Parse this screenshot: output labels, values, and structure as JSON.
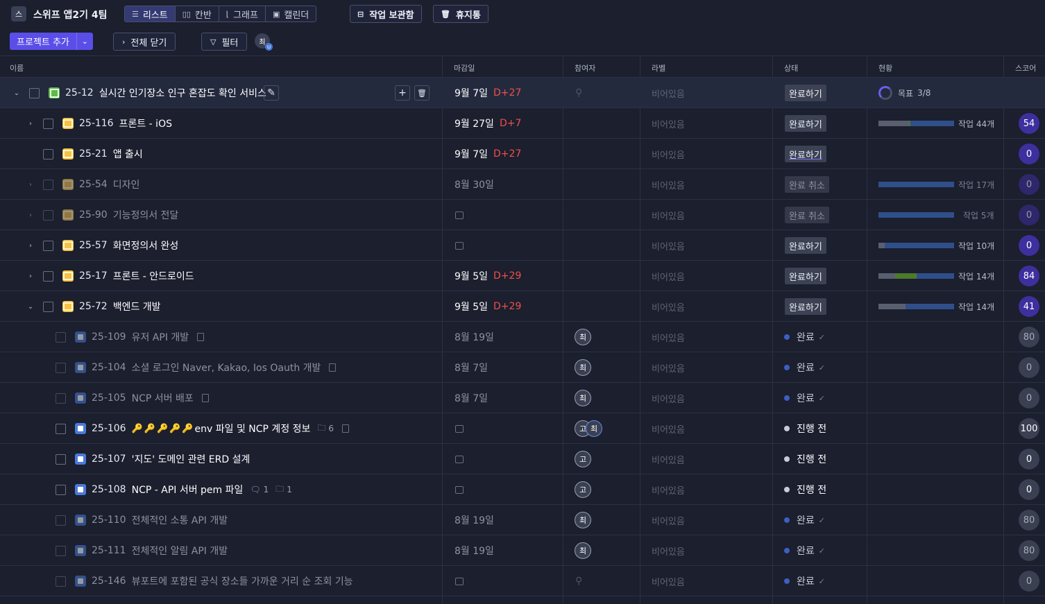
{
  "app": {
    "team_logo": "스",
    "team_name": "스위프 앱2기 4팀"
  },
  "views": {
    "list": "리스트",
    "kanban": "칸반",
    "graph": "그래프",
    "calendar": "캘린더"
  },
  "top_buttons": {
    "archive": "작업 보관함",
    "trash": "휴지통"
  },
  "toolbar": {
    "add_project": "프로젝트 추가",
    "collapse_all": "전체 닫기",
    "filter": "필터",
    "filter_avatar": "최"
  },
  "columns": {
    "name": "이름",
    "due": "마감일",
    "participants": "참여자",
    "label": "라벨",
    "status": "상태",
    "progress": "현황",
    "score": "스코어"
  },
  "rows": [
    {
      "code": "25-12",
      "title": "실시간 인기장소 인구 혼잡도 확인 서비스",
      "date": "9월 7일",
      "dday": "D+27",
      "label": "비어있음",
      "status": "완료하기",
      "goal": "목표",
      "goal_count": "3/8"
    },
    {
      "code": "25-116",
      "title": "프론트 - iOS",
      "date": "9월 27일",
      "dday": "D+7",
      "label": "비어있음",
      "status": "완료하기",
      "tasks": "작업 44개",
      "score": "54",
      "progress": {
        "gray": 0.4,
        "green": 0.02
      }
    },
    {
      "code": "25-21",
      "title": "앱 출시",
      "date": "9월 7일",
      "dday": "D+27",
      "label": "비어있음",
      "status": "완료하기",
      "score": "0"
    },
    {
      "code": "25-54",
      "title": "디자인",
      "date": "8월 30일",
      "label": "비어있음",
      "status": "완료 취소",
      "tasks": "작업 17개",
      "score": "0",
      "progress": {
        "gray": 0,
        "green": 0
      }
    },
    {
      "code": "25-90",
      "title": "기능정의서 전달",
      "label": "비어있음",
      "status": "완료 취소",
      "tasks": "작업 5개",
      "score": "0",
      "progress": {
        "gray": 0,
        "green": 0
      }
    },
    {
      "code": "25-57",
      "title": "화면정의서 완성",
      "label": "비어있음",
      "status": "완료하기",
      "tasks": "작업 10개",
      "score": "0",
      "progress": {
        "gray": 0.08,
        "green": 0
      }
    },
    {
      "code": "25-17",
      "title": "프론트 - 안드로이드",
      "date": "9월 5일",
      "dday": "D+29",
      "label": "비어있음",
      "status": "완료하기",
      "tasks": "작업 14개",
      "score": "84",
      "progress": {
        "gray": 0.22,
        "green": 0.28
      }
    },
    {
      "code": "25-72",
      "title": "백엔드 개발",
      "date": "9월 5일",
      "dday": "D+29",
      "label": "비어있음",
      "status": "완료하기",
      "tasks": "작업 14개",
      "score": "41",
      "progress": {
        "gray": 0.36,
        "green": 0
      }
    },
    {
      "code": "25-109",
      "title": "유저 API 개발",
      "date": "8월 19일",
      "avatar": "최",
      "label": "비어있음",
      "status": "완료",
      "score": "80"
    },
    {
      "code": "25-104",
      "title": "소셜 로그인 Naver, Kakao, Ios Oauth 개발",
      "date": "8월 7일",
      "avatar": "최",
      "label": "비어있음",
      "status": "완료",
      "score": "0"
    },
    {
      "code": "25-105",
      "title": "NCP 서버 배포",
      "date": "8월 7일",
      "avatar": "최",
      "label": "비어있음",
      "status": "완료",
      "score": "0"
    },
    {
      "code": "25-106",
      "title": "env 파일 및 NCP 계정 정보",
      "folder_count": "6",
      "avatar": "고",
      "avatar2": "최",
      "label": "비어있음",
      "status": "진행 전",
      "score": "100"
    },
    {
      "code": "25-107",
      "title": "'지도' 도메인 관련 ERD 설계",
      "avatar": "고",
      "label": "비어있음",
      "status": "진행 전",
      "score": "0"
    },
    {
      "code": "25-108",
      "title": "NCP - API 서버 pem 파일",
      "comment_count": "1",
      "folder_count": "1",
      "avatar": "고",
      "label": "비어있음",
      "status": "진행 전",
      "score": "0"
    },
    {
      "code": "25-110",
      "title": "전체적인 소통 API 개발",
      "date": "8월 19일",
      "avatar": "최",
      "label": "비어있음",
      "status": "완료",
      "score": "80"
    },
    {
      "code": "25-111",
      "title": "전체적인 알림 API 개발",
      "date": "8월 19일",
      "avatar": "최",
      "label": "비어있음",
      "status": "완료",
      "score": "80"
    },
    {
      "code": "25-146",
      "title": "뷰포트에 포함된 공식 장소들 가까운 거리 순 조회 기능",
      "label": "비어있음",
      "status": "완료",
      "score": "0"
    }
  ],
  "colors": {
    "accent": "#5a4ee8",
    "dday": "#f0504a",
    "status_done": "#3b5fc4",
    "status_todo": "#c8ccd8",
    "progress_base": "#2f4f8a",
    "progress_gray": "#5a5f70",
    "progress_green": "#4e7a2c"
  }
}
